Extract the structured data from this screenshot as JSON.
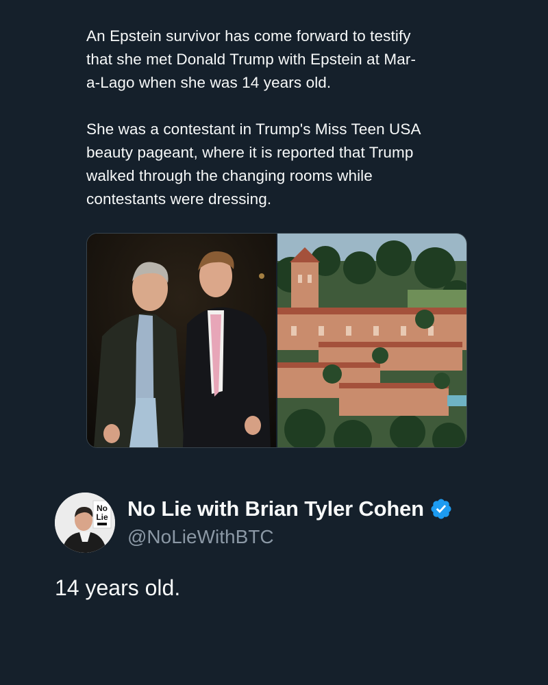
{
  "quoted_tweet": {
    "paragraphs": [
      "An Epstein survivor has come forward to testify\nthat she met Donald Trump with Epstein at Mar-\na-Lago when she was 14 years old.",
      "She was a contestant in Trump's Miss Teen USA\nbeauty pageant, where it is reported that Trump\nwalked through the changing rooms while\ncontestants were dressing."
    ],
    "media": [
      {
        "name": "photo-two-men"
      },
      {
        "name": "photo-estate-aerial"
      }
    ]
  },
  "author": {
    "display_name": "No Lie with Brian Tyler Cohen",
    "handle": "@NoLieWithBTC",
    "verified": true,
    "avatar_logo_line1": "No",
    "avatar_logo_line2": "Lie",
    "verified_color": "#1d9bf0"
  },
  "tweet": {
    "text": "14 years old."
  },
  "colors": {
    "background": "#15202b",
    "text_primary": "#f7f9f9",
    "text_secondary": "#8b98a5"
  }
}
